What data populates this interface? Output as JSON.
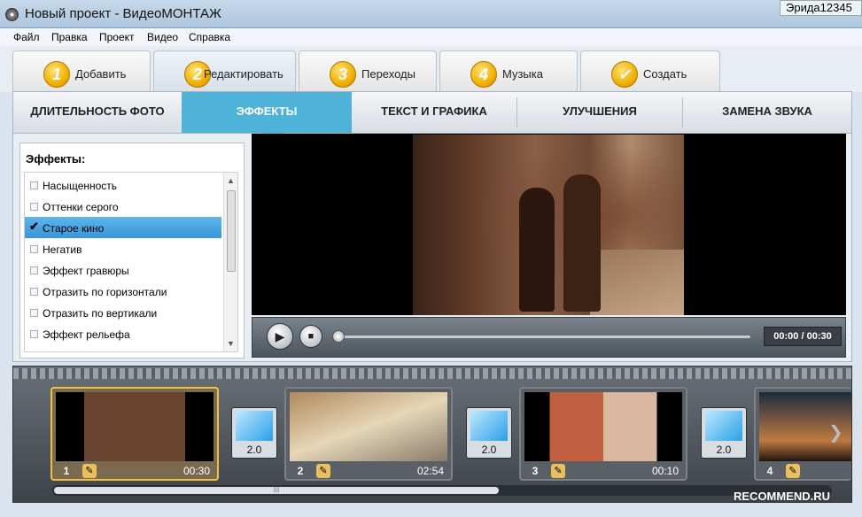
{
  "window": {
    "title": "Новый проект - ВидеоМОНТАЖ",
    "user": "Эрида12345"
  },
  "menu": [
    "Файл",
    "Правка",
    "Проект",
    "Видео",
    "Справка"
  ],
  "steps": [
    {
      "num": "1",
      "label": "Добавить"
    },
    {
      "num": "2",
      "label": "Редактировать"
    },
    {
      "num": "3",
      "label": "Переходы"
    },
    {
      "num": "4",
      "label": "Музыка"
    },
    {
      "num": "✓",
      "label": "Создать"
    }
  ],
  "tabs": [
    "ДЛИТЕЛЬНОСТЬ ФОТО",
    "ЭФФЕКТЫ",
    "ТЕКСТ И ГРАФИКА",
    "УЛУЧШЕНИЯ",
    "ЗАМЕНА ЗВУКА"
  ],
  "effects": {
    "title": "Эффекты:",
    "items": [
      {
        "label": "Насыщенность",
        "checked": false
      },
      {
        "label": "Оттенки серого",
        "checked": false
      },
      {
        "label": "Старое кино",
        "checked": true
      },
      {
        "label": "Негатив",
        "checked": false
      },
      {
        "label": "Эффект гравюры",
        "checked": false
      },
      {
        "label": "Отразить по горизонтали",
        "checked": false
      },
      {
        "label": "Отразить по вертикали",
        "checked": false
      },
      {
        "label": "Эффект рельефа",
        "checked": false
      }
    ],
    "check_mark": "✔"
  },
  "player": {
    "time": "00:00 / 00:30",
    "play_icon": "▶",
    "stop_icon": "■"
  },
  "timeline": {
    "clips": [
      {
        "num": "1",
        "duration": "00:30"
      },
      {
        "num": "2",
        "duration": "02:54"
      },
      {
        "num": "3",
        "duration": "00:10"
      },
      {
        "num": "4",
        "duration": ""
      }
    ],
    "transitions": [
      "2.0",
      "2.0",
      "2.0"
    ],
    "pencil_icon": "✎",
    "scroll_grip": "||||",
    "next_icon": "❯"
  },
  "watermark": "RECOMMEND.RU"
}
